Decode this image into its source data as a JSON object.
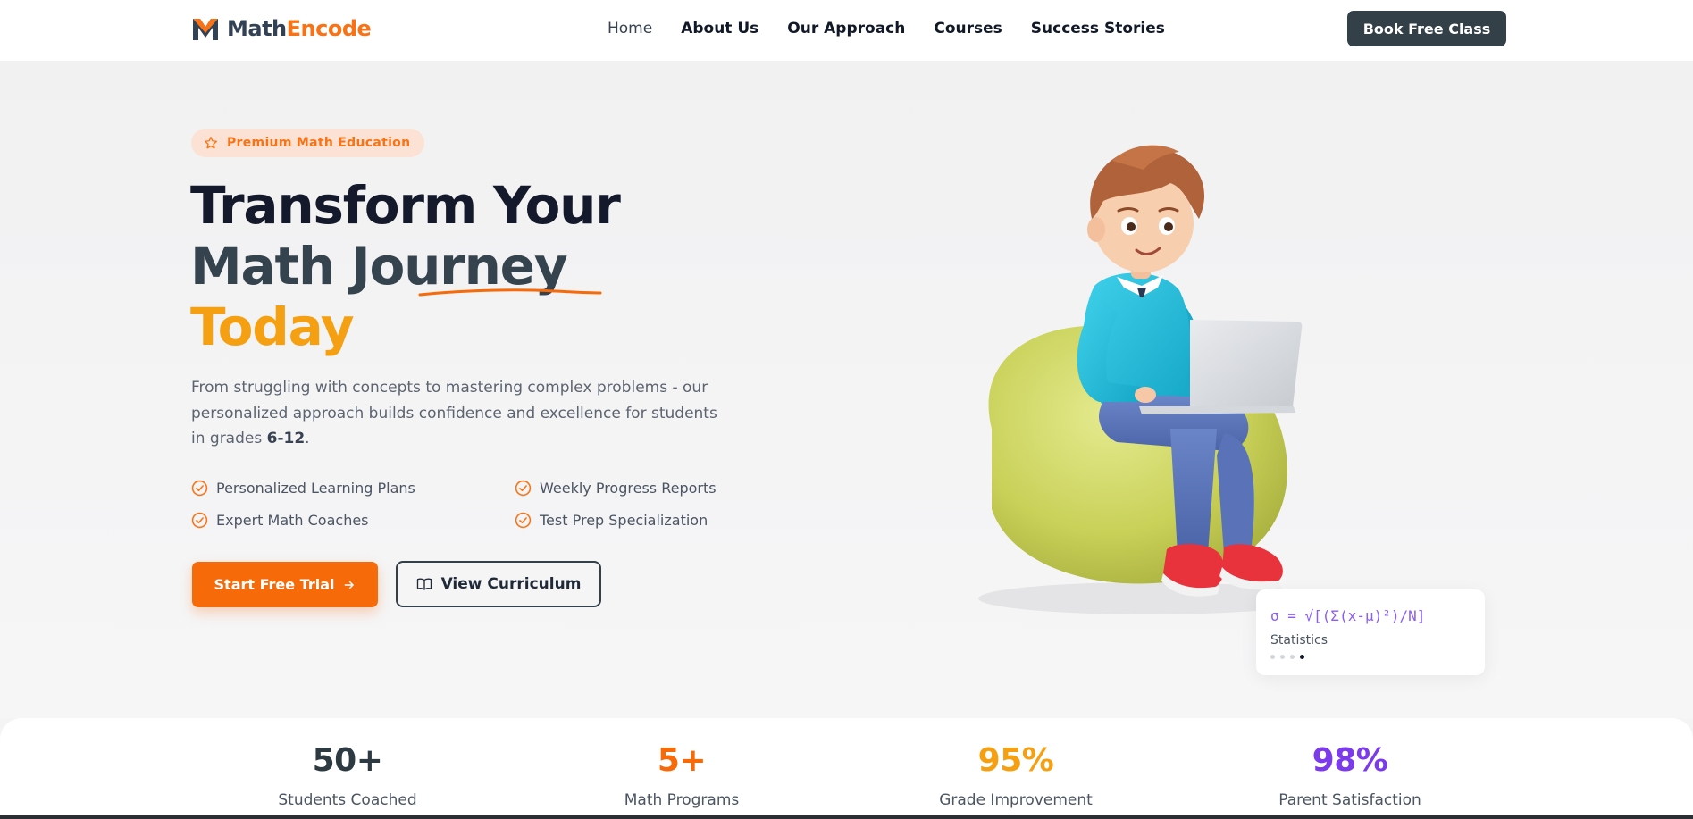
{
  "header": {
    "logo": {
      "part1": "Math",
      "part2": "Encode"
    },
    "nav": [
      {
        "label": "Home"
      },
      {
        "label": "About Us"
      },
      {
        "label": "Our Approach"
      },
      {
        "label": "Courses"
      },
      {
        "label": "Success Stories"
      }
    ],
    "cta_label": "Book Free Class"
  },
  "hero": {
    "badge": "Premium Math Education",
    "title": {
      "line1": "Transform Your",
      "line2": "Math Journey",
      "line3": "Today"
    },
    "description": {
      "text": "From struggling with concepts to mastering complex problems - our personalized approach builds confidence and excellence for students in grades ",
      "grades": "6-12",
      "end": "."
    },
    "features": [
      {
        "label": "Personalized Learning Plans"
      },
      {
        "label": "Weekly Progress Reports"
      },
      {
        "label": "Expert Math Coaches"
      },
      {
        "label": "Test Prep Specialization"
      }
    ],
    "primary_button": "Start Free Trial",
    "secondary_button": "View Curriculum"
  },
  "formula_card": {
    "formula": "σ = √[(Σ(x-μ)²)/N]",
    "label": "Statistics",
    "active_dot": 4,
    "dot_count": 4
  },
  "stats": [
    {
      "value": "50+",
      "label": "Students Coached",
      "color": "#2d3a42"
    },
    {
      "value": "5+",
      "label": "Math Programs",
      "color": "#f76a0a"
    },
    {
      "value": "95%",
      "label": "Grade Improvement",
      "color": "#f5a012"
    },
    {
      "value": "98%",
      "label": "Parent Satisfaction",
      "color": "#7c3aed"
    }
  ],
  "colors": {
    "brand_orange": "#f97316",
    "dark": "#334047",
    "accent_yellow": "#f5a012",
    "accent_purple": "#8b5cf6"
  }
}
